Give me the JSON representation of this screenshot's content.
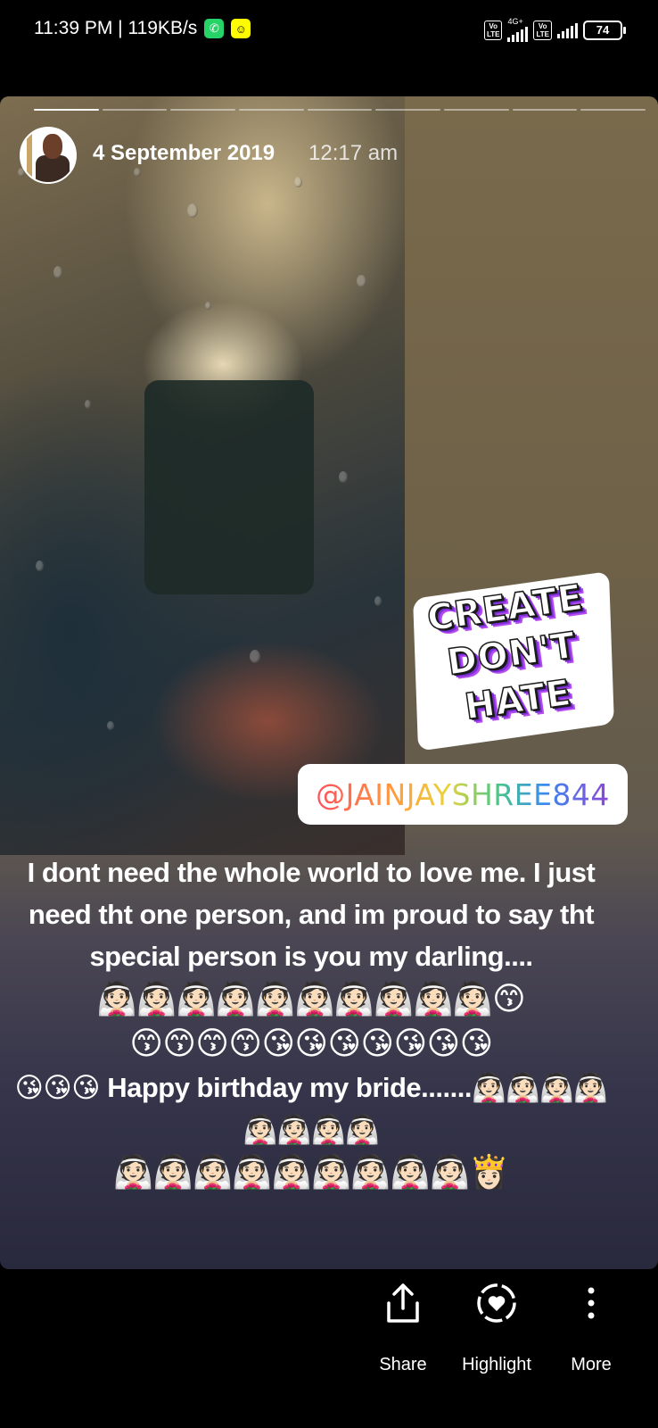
{
  "status_bar": {
    "time": "11:39 PM",
    "network_speed": "119KB/s",
    "notification_icons": [
      "whatsapp-icon",
      "snapchat-icon"
    ],
    "sim1_label": "Vo LTE",
    "network_type": "4G+",
    "sim2_label": "Vo LTE",
    "battery_level": "74"
  },
  "story": {
    "progress_total": 9,
    "progress_current": 1,
    "date": "4 September 2019",
    "time": "12:17 am",
    "sticker_lines": [
      "CREATE",
      "DON'T",
      "HATE"
    ],
    "mention": "@JAINJAYSHREE844",
    "caption_text": "I dont need the whole world  to love me. I just need tht one person, and im proud to say tht special person is you my darling....",
    "emoji_line_1": "👰🏻👰🏻👰🏻👰🏻👰🏻👰🏻👰🏻👰🏻👰🏻👰🏻😙",
    "emoji_line_2": "😙😙😙😙😘😘😘😘😘😘😘",
    "caption_greeting": "😘😘😘 Happy birthday my bride.......👰🏻👰🏻👰🏻👰🏻👰🏻👰🏻👰🏻👰🏻",
    "emoji_line_3": "👰🏻👰🏻👰🏻👰🏻👰🏻👰🏻👰🏻👰🏻👰🏻👸🏻"
  },
  "actions": {
    "share_label": "Share",
    "highlight_label": "Highlight",
    "more_label": "More"
  },
  "colors": {
    "background": "#000000",
    "sticker_shadow": "#7b2fd6"
  }
}
